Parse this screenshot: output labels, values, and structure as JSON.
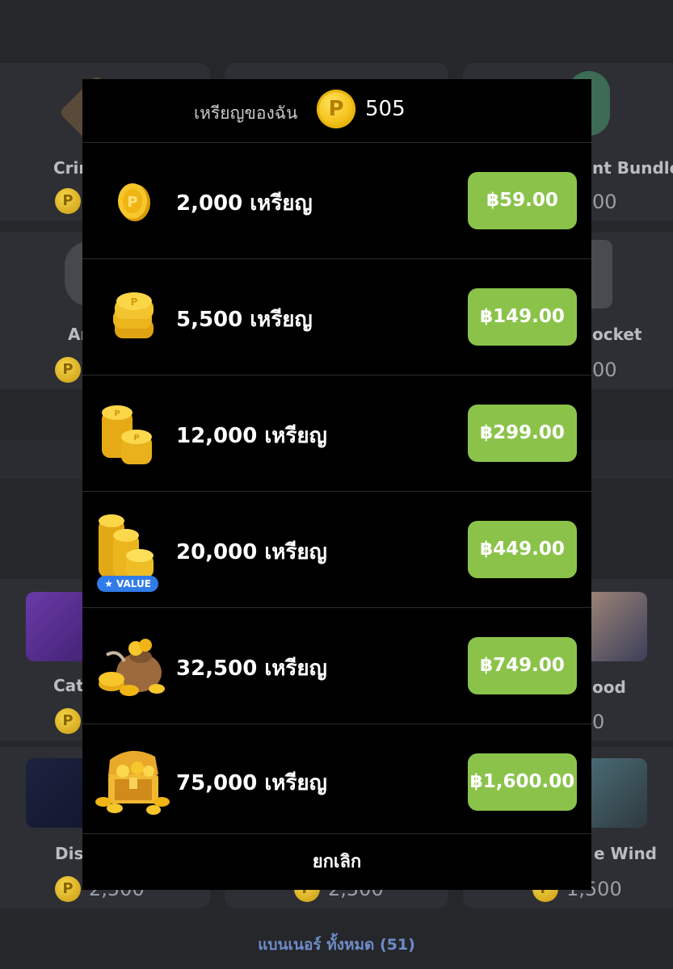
{
  "balance": {
    "label": "เหรียญของฉัน",
    "coin_symbol": "P",
    "value": "505"
  },
  "packages": [
    {
      "amount": "2,000 เหรียญ",
      "price": "฿59.00",
      "icon": "single-coin-icon"
    },
    {
      "amount": "5,500 เหรียญ",
      "price": "฿149.00",
      "icon": "coin-stack-icon"
    },
    {
      "amount": "12,000 เหรียญ",
      "price": "฿299.00",
      "icon": "coin-stacks-icon"
    },
    {
      "amount": "20,000 เหรียญ",
      "price": "฿449.00",
      "icon": "coin-tower-icon",
      "badge": "★ VALUE"
    },
    {
      "amount": "32,500 เหรียญ",
      "price": "฿749.00",
      "icon": "coin-bag-icon"
    },
    {
      "amount": "75,000 เหรียญ",
      "price": "฿1,600.00",
      "icon": "treasure-chest-icon"
    }
  ],
  "cancel_label": "ยกเลิก",
  "background_store": {
    "tiles": [
      {
        "name": "Crim",
        "price": ""
      },
      {
        "name": "nt Bundle",
        "price": "00"
      },
      {
        "name": "Ar",
        "price": ""
      },
      {
        "name": "ocket",
        "price": "00"
      },
      {
        "name": "Cat",
        "price": ""
      },
      {
        "name": "ood",
        "price": "0"
      },
      {
        "name": "Dis",
        "price": "2,500"
      },
      {
        "name": "",
        "price": "2,500"
      },
      {
        "name": "e Wind",
        "price": "1,500"
      }
    ],
    "footer_link": "แบนเนอร์ ทั้งหมด (51)"
  },
  "colors": {
    "buy_button": "#8bc34a",
    "modal_bg": "#000000",
    "page_bg": "#26272b",
    "value_badge": "#2f7be8"
  }
}
